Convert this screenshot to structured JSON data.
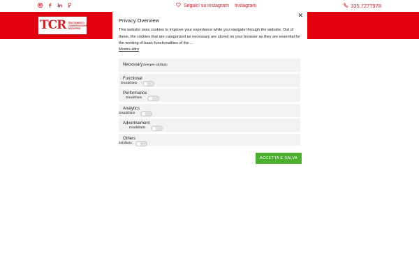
{
  "topbar": {
    "social_icons": [
      "instagram-icon",
      "facebook-icon",
      "linkedin-icon",
      "foursquare-icon"
    ],
    "follow_label": "Seguici su instagram",
    "follow_link": "Instagram",
    "phone": "335.7277978"
  },
  "logo": {
    "mark": "TCR",
    "text_lines": [
      "TRATTAMENTO",
      "CONSERVAZIONE",
      "RECUPERO"
    ]
  },
  "modal": {
    "title": "Privacy Overview",
    "close_label": "✕",
    "description": "This website uses cookies to improve your experience while you navigate through the website. Out of these, the cookies that are categorized as necessary are stored on your browser as they are essential for the working of basic functionalities of the ...",
    "read_more": "Mostra altro",
    "categories": [
      {
        "name": "Necessary",
        "status": "Sempre abilitato"
      },
      {
        "name": "Functional",
        "status": "Disabilitato"
      },
      {
        "name": "Performance",
        "status": "Disabilitato"
      },
      {
        "name": "Analytics",
        "status": "Disabilitato"
      },
      {
        "name": "Advertisement",
        "status": "Disabilitato"
      },
      {
        "name": "Others",
        "status": "sabilitato"
      }
    ],
    "accept_button": "ACCETTA E SALVA"
  },
  "colors": {
    "brand_red": "#e2000f",
    "accent_red": "#c8242b",
    "accept_green": "#4caf2e",
    "category_bg": "#f2f2f2"
  }
}
